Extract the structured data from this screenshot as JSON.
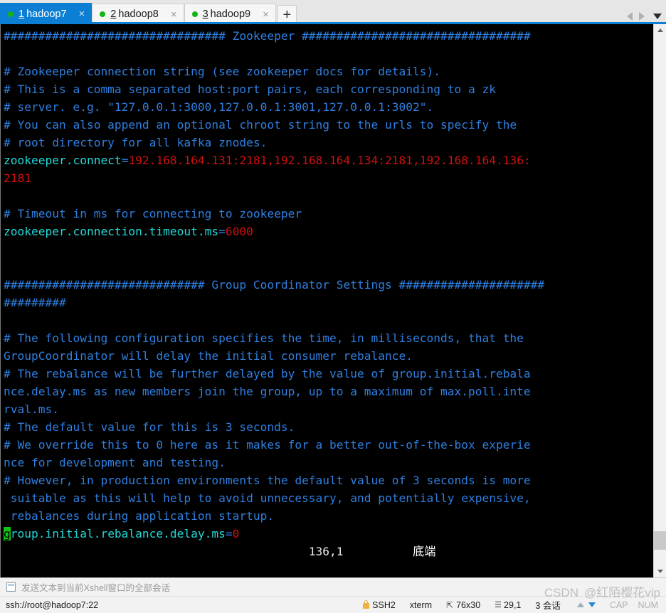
{
  "tabs": [
    {
      "num": "1",
      "label": "hadoop7",
      "active": true,
      "close": "×",
      "status_dot": "connected"
    },
    {
      "num": "2",
      "label": "hadoop8",
      "active": false,
      "close": "×",
      "status_dot": "connected"
    },
    {
      "num": "3",
      "label": "hadoop9",
      "active": false,
      "close": "×",
      "status_dot": "connected"
    }
  ],
  "tabbar": {
    "new_tab_label": "+",
    "prev_tab_icon": "triangle-left-icon",
    "next_tab_icon": "triangle-right-icon",
    "tab_list_icon": "chevron-down-icon"
  },
  "terminal": {
    "lines": [
      {
        "segments": [
          {
            "t": "################################ Zookeeper #################################",
            "c": "cmt"
          }
        ]
      },
      {
        "segments": [
          {
            "t": "",
            "c": "cmt"
          }
        ]
      },
      {
        "segments": [
          {
            "t": "# Zookeeper connection string (see zookeeper docs for details).",
            "c": "cmt"
          }
        ]
      },
      {
        "segments": [
          {
            "t": "# This is a comma separated host:port pairs, each corresponding to a zk",
            "c": "cmt"
          }
        ]
      },
      {
        "segments": [
          {
            "t": "# server. e.g. \"127.0.0.1:3000,127.0.0.1:3001,127.0.0.1:3002\".",
            "c": "cmt"
          }
        ]
      },
      {
        "segments": [
          {
            "t": "# You can also append an optional chroot string to the urls to specify the",
            "c": "cmt"
          }
        ]
      },
      {
        "segments": [
          {
            "t": "# root directory for all kafka znodes.",
            "c": "cmt"
          }
        ]
      },
      {
        "segments": [
          {
            "t": "zookeeper.connect",
            "c": "key"
          },
          {
            "t": "=",
            "c": "eq"
          },
          {
            "t": "192.168.164.131:2181,192.168.164.136:",
            "c": "val"
          }
        ]
      },
      {
        "segments": [
          {
            "t": "2181",
            "c": "val"
          }
        ]
      },
      {
        "segments": [
          {
            "t": "",
            "c": "cmt"
          }
        ]
      },
      {
        "segments": [
          {
            "t": "# Timeout in ms for connecting to zookeeper",
            "c": "cmt"
          }
        ]
      },
      {
        "segments": [
          {
            "t": "zookeeper.connection.timeout.ms",
            "c": "key"
          },
          {
            "t": "=",
            "c": "eq"
          },
          {
            "t": "6000",
            "c": "val"
          }
        ]
      },
      {
        "segments": [
          {
            "t": "",
            "c": "cmt"
          }
        ]
      },
      {
        "segments": [
          {
            "t": "",
            "c": "cmt"
          }
        ]
      },
      {
        "segments": [
          {
            "t": "############################# Group Coordinator Settings #####################",
            "c": "cmt"
          }
        ]
      },
      {
        "segments": [
          {
            "t": "#########",
            "c": "cmt"
          }
        ]
      },
      {
        "segments": [
          {
            "t": "",
            "c": "cmt"
          }
        ]
      },
      {
        "segments": [
          {
            "t": "# The following configuration specifies the time, in milliseconds, that the",
            "c": "cmt"
          }
        ]
      },
      {
        "segments": [
          {
            "t": "GroupCoordinator will delay the initial consumer rebalance.",
            "c": "cmt"
          }
        ]
      },
      {
        "segments": [
          {
            "t": "# The rebalance will be further delayed by the value of group.initial.rebala",
            "c": "cmt"
          }
        ]
      },
      {
        "segments": [
          {
            "t": "nce.delay.ms as new members join the group, up to a maximum of max.poll.inte",
            "c": "cmt"
          }
        ]
      },
      {
        "segments": [
          {
            "t": "rval.ms.",
            "c": "cmt"
          }
        ]
      },
      {
        "segments": [
          {
            "t": "# The default value for this is 3 seconds.",
            "c": "cmt"
          }
        ]
      },
      {
        "segments": [
          {
            "t": "# We override this to 0 here as it makes for a better out-of-the-box experie",
            "c": "cmt"
          }
        ]
      },
      {
        "segments": [
          {
            "t": "nce for development and testing.",
            "c": "cmt"
          }
        ]
      },
      {
        "segments": [
          {
            "t": "# However, in production environments the default value of 3 seconds is more",
            "c": "cmt"
          }
        ]
      },
      {
        "segments": [
          {
            "t": " suitable as this will help to avoid unnecessary, and potentially expensive,",
            "c": "cmt"
          }
        ]
      },
      {
        "segments": [
          {
            "t": " rebalances during application startup.",
            "c": "cmt"
          }
        ]
      },
      {
        "segments": [
          {
            "t": "g",
            "c": "cur"
          },
          {
            "t": "roup.initial.rebalance.delay.ms",
            "c": "key"
          },
          {
            "t": "=",
            "c": "eq"
          },
          {
            "t": "0",
            "c": "val"
          }
        ]
      }
    ],
    "long_connect_value": "192.168.164.131:2181,192.168.164.134:2181,192.168.164.136:",
    "status_position": "136,1",
    "status_marker": "底端"
  },
  "sendbar": {
    "checkbox_state": "unchecked",
    "label": "发送文本到当前Xshell窗口的全部会话"
  },
  "statusbar": {
    "path": "ssh://root@hadoop7:22",
    "protocol": "SSH2",
    "terminal_type": "xterm",
    "size": "76x30",
    "cursor_position": "29,1",
    "sessions": "3 会话",
    "cap": "CAP",
    "num": "NUM",
    "lock_icon": "lock-icon",
    "size_icon": "resize-icon",
    "pos_icon": "cursor-position-icon",
    "upload_icon": "arrow-up-icon",
    "download_icon": "arrow-down-icon"
  },
  "watermark": {
    "brand": "CSDN",
    "handle": "@红陌樱花vip"
  },
  "colors": {
    "accent": "#0c7fd4",
    "terminal_bg": "#000000",
    "comment": "#2f7fe0",
    "key": "#23d8d8",
    "value": "#d01010",
    "cursor": "#13c413",
    "tab_dot": "#12b512"
  }
}
